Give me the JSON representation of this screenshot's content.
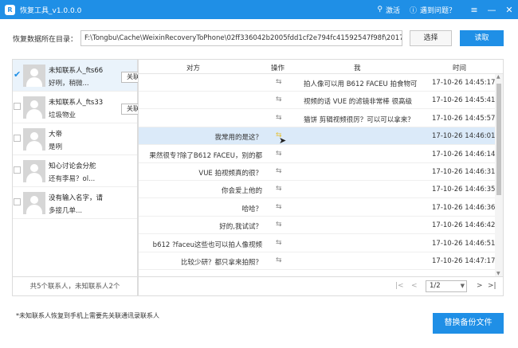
{
  "window": {
    "title": "恢复工具_v1.0.0.0",
    "activate_label": "激活",
    "help_label": "遇到问题？",
    "icons": [
      "pin-icon",
      "help-icon",
      "menu-icon",
      "minimize-icon",
      "close-icon"
    ]
  },
  "path_bar": {
    "label": "恢复数据所在目录：",
    "path": "F:\\Tongbu\\Cache\\WeixinRecoveryToPhone\\02ff336042b2005fdd1cf2e794fc41592547f98f\\201711171750",
    "choose_label": "选择",
    "read_label": "读取"
  },
  "contacts": {
    "items": [
      {
        "name": "未知联系人_fts66",
        "sub": "好咧，稍微...",
        "selected": true,
        "link_label": "关联"
      },
      {
        "name": "未知联系人_fts33",
        "sub": "垃圾物业",
        "selected": false,
        "link_label": "关联"
      },
      {
        "name": "大帝",
        "sub": "是咧",
        "selected": false
      },
      {
        "name": "知心讨论会分舵",
        "sub": "还有李易？ol...",
        "selected": false
      },
      {
        "name": "没有输入名字，请",
        "sub": "多接几单...",
        "selected": false
      }
    ],
    "summary": "共5个联系人，未知联系人2个"
  },
  "messages": {
    "headers": {
      "other": "对方",
      "action": "操作",
      "me": "我",
      "time": "时间"
    },
    "rows": [
      {
        "other": "",
        "me": "拍人像可以用 B612 FACEU 拍食物可",
        "time": "17-10-26 14:45:17",
        "highlight": false
      },
      {
        "other": "",
        "me": "视频的话 VUE 的滤镜非常棒 很高级",
        "time": "17-10-26 14:45:41",
        "highlight": false
      },
      {
        "other": "",
        "me": "猫饼 剪辑视频很厉？可以可以拿来？",
        "time": "17-10-26 14:45:57",
        "highlight": false
      },
      {
        "other": "我常用的是这？",
        "me": "",
        "time": "17-10-26 14:46:01",
        "highlight": true
      },
      {
        "other": "果然很专?除了B612 FACEU，别的都",
        "me": "",
        "time": "17-10-26 14:46:14",
        "highlight": false
      },
      {
        "other": "VUE 拍视频真的很？",
        "me": "",
        "time": "17-10-26 14:46:31",
        "highlight": false
      },
      {
        "other": "你会爱上他的",
        "me": "",
        "time": "17-10-26 14:46:35",
        "highlight": false
      },
      {
        "other": "哈哈？",
        "me": "",
        "time": "17-10-26 14:46:36",
        "highlight": false
      },
      {
        "other": "好的,我试试？",
        "me": "",
        "time": "17-10-26 14:46:42",
        "highlight": false
      },
      {
        "other": "b612 ?faceu这些也可以拍人像视频",
        "me": "",
        "time": "17-10-26 14:46:51",
        "highlight": false
      },
      {
        "other": "比较少研？都只拿来拍照？",
        "me": "",
        "time": "17-10-26 14:47:17",
        "highlight": false
      }
    ],
    "swap_glyph": "⇆",
    "page": "1/2"
  },
  "footer": {
    "note": "*未知联系人恢复到手机上需要先关联通讯录联系人",
    "replace_label": "替换备份文件"
  }
}
